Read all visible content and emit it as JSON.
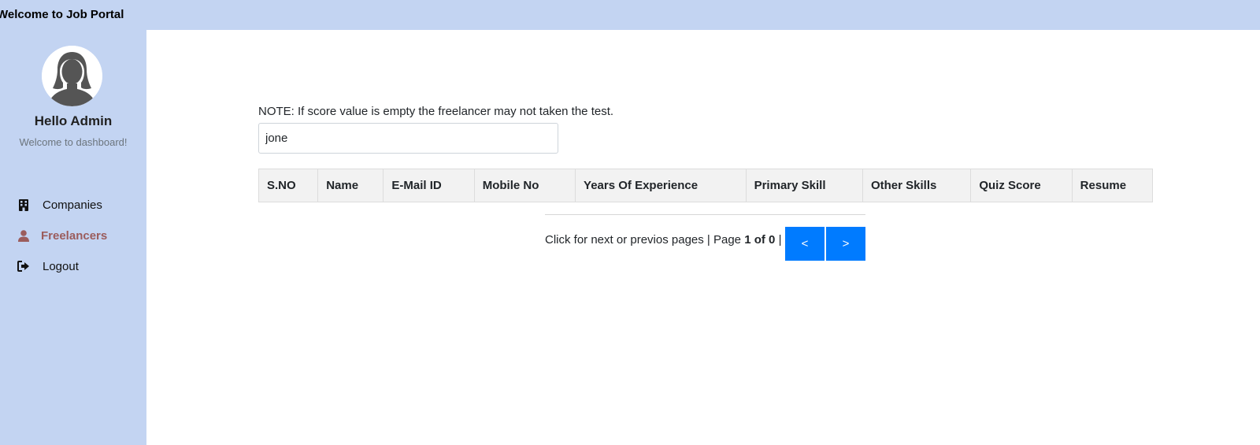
{
  "header": {
    "title": "Welcome to Job Portal"
  },
  "profile": {
    "greeting": "Hello Admin",
    "subtitle": "Welcome to dashboard!"
  },
  "sidebar": {
    "items": [
      {
        "label": "Companies",
        "icon": "building-icon",
        "active": false
      },
      {
        "label": "Freelancers",
        "icon": "user-icon",
        "active": true
      },
      {
        "label": "Logout",
        "icon": "logout-icon",
        "active": false
      }
    ]
  },
  "main": {
    "note": "NOTE: If score value is empty the freelancer may not taken the test.",
    "search": {
      "value": "jone",
      "placeholder": ""
    },
    "table": {
      "columns": [
        "S.NO",
        "Name",
        "E-Mail ID",
        "Mobile No",
        "Years Of Experience",
        "Primary Skill",
        "Other Skills",
        "Quiz Score",
        "Resume"
      ],
      "rows": []
    },
    "pagination": {
      "text": "Click for next or previos pages | Page",
      "page_info": "1 of 0",
      "separator": "|",
      "prev_label": "<",
      "next_label": ">"
    }
  },
  "colors": {
    "sidebar_bg": "#c3d4f2",
    "accent": "#007bff",
    "active_nav": "#9b5c5c"
  }
}
